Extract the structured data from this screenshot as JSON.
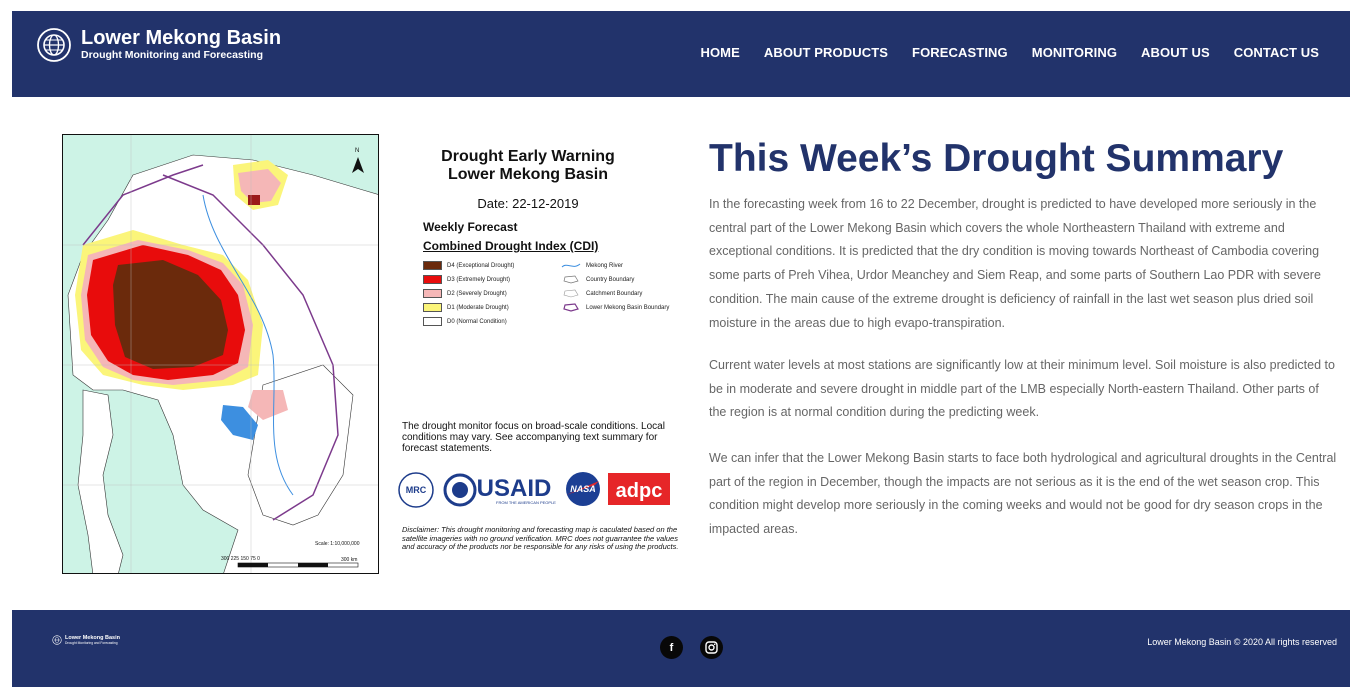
{
  "header": {
    "logo_title": "Lower Mekong Basin",
    "logo_subtitle": "Drought Monitoring and Forecasting",
    "nav": [
      "HOME",
      "ABOUT PRODUCTS",
      "FORECASTING",
      "MONITORING",
      "ABOUT US",
      "CONTACT US"
    ]
  },
  "map": {
    "title_line1": "Drought Early Warning",
    "title_line2": "Lower Mekong Basin",
    "date": "Date: 22-12-2019",
    "weekly": "Weekly Forecast",
    "index_title": "Combined Drought Index (CDI)",
    "legend": [
      {
        "label": "D4 (Exceptional Drought)",
        "color": "#6b2a0c"
      },
      {
        "label": "D3 (Extremely Drought)",
        "color": "#e80c0c"
      },
      {
        "label": "D2 (Severely Drought)",
        "color": "#f5b7b7"
      },
      {
        "label": "D1 (Moderate Drought)",
        "color": "#fbf57a"
      },
      {
        "label": "D0 (Normal Condition)",
        "color": "#ffffff"
      }
    ],
    "legend_lines": [
      "Mekong River",
      "Country Boundary",
      "Catchment Boundary",
      "Lower Mekong Basin Boundary"
    ],
    "focus_note": "The drought monitor focus on broad-scale conditions. Local conditions may vary. See accompanying text summary for forecast statements.",
    "disclaimer": "Disclaimer: This drought monitoring and forecasting map is caculated based on the satellite imageries with no ground verification. MRC does not guarrantee the values and accuracy of the products nor be responsible for any risks of using the products.",
    "scale_text": "Scale: 1:10,000,000",
    "scale_ticks": "300  225  150   75    0",
    "scale_unit": "300  km",
    "partner_logos": [
      "MRC",
      "USAID",
      "FROM THE AMERICAN PEOPLE",
      "NASA",
      "adpc"
    ],
    "north": "N"
  },
  "summary": {
    "title": "This Week’s Drought Summary",
    "paragraphs": [
      "In the forecasting week from 16 to 22 December, drought is predicted to have developed more seriously in the central part of the Lower Mekong Basin  which covers the whole Northeastern Thailand with extreme and exceptional conditions. It is predicted that the dry condition is moving towards Northeast of Cambodia covering some parts of Preh Vihea, Urdor Meanchey and Siem Reap, and some parts of Southern Lao PDR with severe condition. The main cause of the extreme drought is deficiency of rainfall in the last wet season plus dried soil moisture in the areas due to high evapo-transpiration.",
      "Current water levels at most stations are significantly low at their minimum level. Soil moisture is also predicted to be in moderate and severe drought in middle part of the LMB especially North-eastern Thailand. Other parts of the region is at normal condition during the predicting week.",
      "We can infer that the Lower Mekong Basin starts to face both hydrological and agricultural droughts in the Central part of the region in December, though the impacts are not serious as it is the end of the wet season crop. This condition might develop more seriously in the coming weeks and would not be good for dry season crops in the impacted areas."
    ]
  },
  "footer": {
    "logo_title": "Lower Mekong Basin",
    "logo_subtitle": "Drought Monitoring and Forecasting",
    "social": [
      "f",
      "ig"
    ],
    "copyright": "Lower Mekong Basin © 2020 All rights reserved"
  },
  "colors": {
    "brand": "#22336b",
    "text_muted": "#666666"
  }
}
